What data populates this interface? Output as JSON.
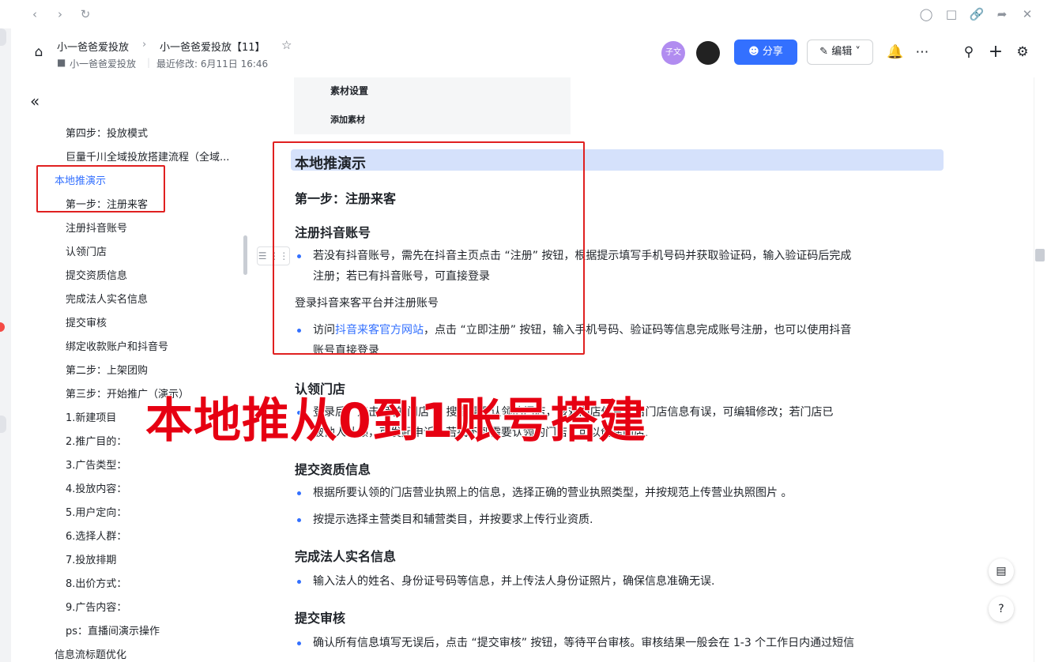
{
  "browser": {
    "back_icon": "chevron-left-icon",
    "forward_icon": "chevron-right-icon",
    "reload_icon": "reload-icon"
  },
  "header": {
    "breadcrumb_root": "小一爸爸爱投放",
    "breadcrumb_current": "小一爸爸爱投放【11】",
    "folder_label": "小一爸爸爱投放",
    "last_modified": "最近修改: 6月11日 16:46",
    "avatar_text": "子文",
    "share_label": "分享",
    "edit_label": "编辑",
    "accent": "#3370ff"
  },
  "sidebar": {
    "items": [
      {
        "label": "第四步：投放模式",
        "level": 2
      },
      {
        "label": "巨量千川全域投放搭建流程（全域...",
        "level": 2
      },
      {
        "label": "本地推演示",
        "level": 1,
        "active": true
      },
      {
        "label": "第一步：注册来客",
        "level": 2
      },
      {
        "label": "注册抖音账号",
        "level": 2
      },
      {
        "label": "认领门店",
        "level": 2
      },
      {
        "label": "提交资质信息",
        "level": 2
      },
      {
        "label": "完成法人实名信息",
        "level": 2
      },
      {
        "label": "提交审核",
        "level": 2
      },
      {
        "label": "绑定收款账户和抖音号",
        "level": 2
      },
      {
        "label": "第二步：上架团购",
        "level": 2
      },
      {
        "label": "第三步：开始推广（演示）",
        "level": 2
      },
      {
        "label": "1.新建项目",
        "level": 2
      },
      {
        "label": "2.推广目的：",
        "level": 2
      },
      {
        "label": "3.广告类型：",
        "level": 2
      },
      {
        "label": "4.投放内容：",
        "level": 2
      },
      {
        "label": "5.用户定向：",
        "level": 2
      },
      {
        "label": "6.选择人群：",
        "level": 2
      },
      {
        "label": "7.投放排期",
        "level": 2
      },
      {
        "label": "8.出价方式：",
        "level": 2
      },
      {
        "label": "9.广告内容：",
        "level": 2
      },
      {
        "label": "ps：直播间演示操作",
        "level": 2
      },
      {
        "label": "信息流标题优化",
        "level": 1
      }
    ]
  },
  "doc": {
    "prev_line1": "素材设置",
    "prev_line2": "添加素材",
    "h1": "本地推演示",
    "step1": "第一步：注册来客",
    "s_register": "注册抖音账号",
    "p_register_1": "若没有抖音账号，需先在抖音主页点击 “注册” 按钮，根据提示填写手机号码并获取验证码，输入验证码后完成",
    "p_register_2": "注册；若已有抖音账号，可直接登录",
    "p_login": "登录抖音来客平台并注册账号",
    "p_visit_pre": "访问",
    "p_visit_link": "抖音来客官方网站",
    "p_visit_post": "，点击 “立即注册” 按钮，输入手机号码、验证码等信息完成账号注册，也可以使用抖音",
    "p_visit_2": "账号直接登录",
    "s_claim": "认领门店",
    "p_claim_1": "登录后，点击“我的门店”，搜索需要认领的门店，核对门店信息。若门店信息有误，可编辑修改；若门店已",
    "p_claim_2": "被他人认领，可发起申诉，若找不到需要认领的门店，可以创建门店.",
    "s_qual": "提交资质信息",
    "p_qual_1": "根据所要认领的门店营业执照上的信息，选择正确的营业执照类型，并按规范上传营业执照图片 。",
    "p_qual_2": "按提示选择主营类目和辅营类目，并按要求上传行业资质.",
    "s_legal": "完成法人实名信息",
    "p_legal": "输入法人的姓名、身份证号码等信息，并上传法人身份证照片，确保信息准确无误.",
    "s_review": "提交审核",
    "p_review": "确认所有信息填写无误后，点击 “提交审核” 按钮，等待平台审核。审核结果一般会在 1-3 个工作日内通过短信"
  },
  "overlay_text": "本地推从0到1账号搭建",
  "annotation_color": "#e02020"
}
